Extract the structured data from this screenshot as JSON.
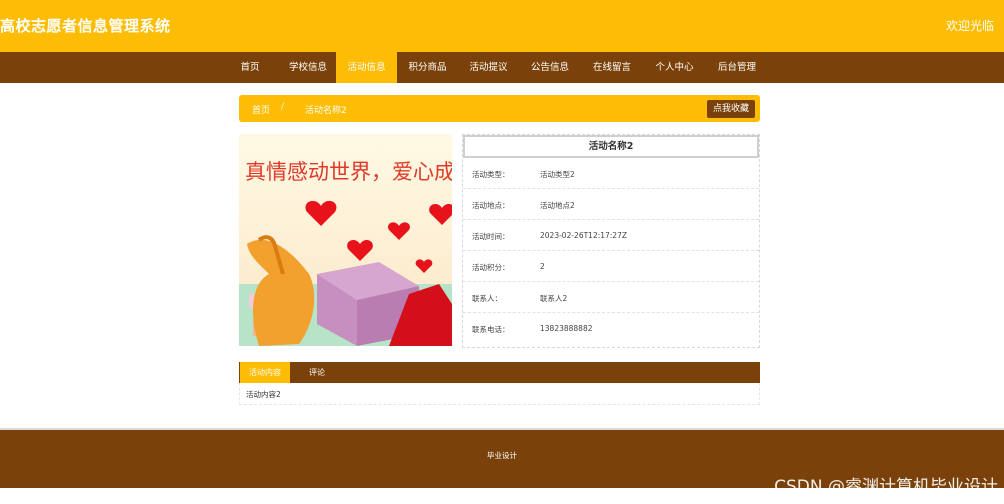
{
  "header": {
    "site_title": "高校志愿者信息管理系统",
    "welcome": "欢迎光临"
  },
  "nav": {
    "items": [
      {
        "label": "首页",
        "active": false
      },
      {
        "label": "学校信息",
        "active": false
      },
      {
        "label": "活动信息",
        "active": true
      },
      {
        "label": "积分商品",
        "active": false
      },
      {
        "label": "活动提议",
        "active": false
      },
      {
        "label": "公告信息",
        "active": false
      },
      {
        "label": "在线留言",
        "active": false
      },
      {
        "label": "个人中心",
        "active": false
      },
      {
        "label": "后台管理",
        "active": false
      }
    ]
  },
  "breadcrumb": {
    "home": "首页",
    "separator": "/",
    "current": "活动名称2",
    "favorite_button": "点我收藏"
  },
  "poster": {
    "text": "真情感动世界，爱心成"
  },
  "detail": {
    "title": "活动名称2",
    "rows": [
      {
        "label": "活动类型：",
        "value": "活动类型2"
      },
      {
        "label": "活动地点：",
        "value": "活动地点2"
      },
      {
        "label": "活动时间：",
        "value": "2023-02-26T12:17:27Z"
      },
      {
        "label": "活动积分：",
        "value": "2"
      },
      {
        "label": "联系人：",
        "value": "联系人2"
      },
      {
        "label": "联系电话：",
        "value": "13823888882"
      }
    ]
  },
  "tabs": {
    "items": [
      {
        "label": "活动内容",
        "active": true
      },
      {
        "label": "评论",
        "active": false
      }
    ],
    "content": "活动内容2"
  },
  "footer": {
    "text": "毕业设计"
  },
  "watermark": "CSDN @睿渊计算机毕业设计",
  "colors": {
    "accent": "#fdbd04",
    "nav_brown": "#7a420a"
  }
}
